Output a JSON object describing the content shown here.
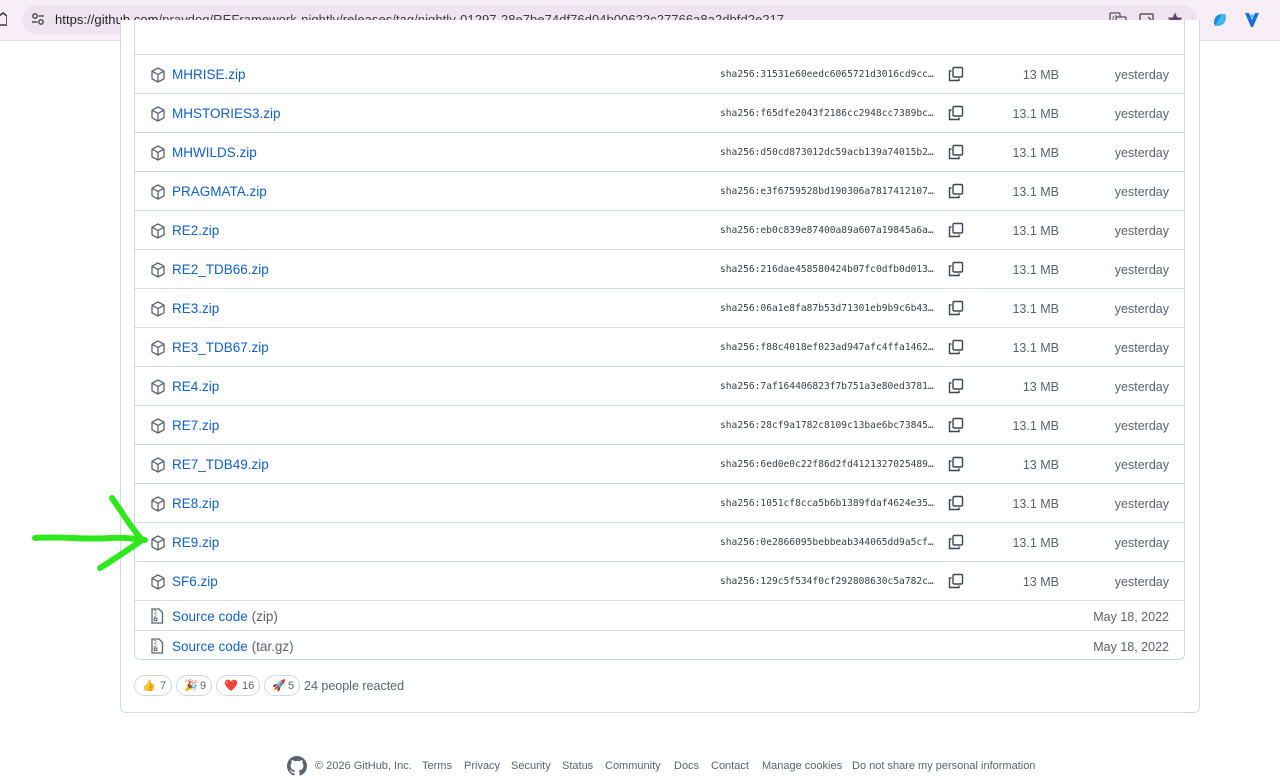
{
  "browser": {
    "url_host": "https://github.com",
    "url_path": "/praydog/REFramework-nightly/releases/tag/nightly-01297-28e7be74df76d04b00622c27766a8a2dbfd2e217",
    "icons": [
      "home-icon",
      "site-settings-icon",
      "translate-icon",
      "install-app-icon",
      "bookmark-star-icon",
      "copilot-icon",
      "extension-icon"
    ]
  },
  "assets": [
    {
      "name": "MHRISE.zip",
      "sha": "sha256:31531e60eedc6065721d3016cd9cc…",
      "size": "13 MB",
      "date": "yesterday"
    },
    {
      "name": "MHSTORIES3.zip",
      "sha": "sha256:f65dfe2043f2186cc2948cc7389bc…",
      "size": "13.1 MB",
      "date": "yesterday"
    },
    {
      "name": "MHWILDS.zip",
      "sha": "sha256:d50cd873012dc59acb139a74015b2…",
      "size": "13.1 MB",
      "date": "yesterday"
    },
    {
      "name": "PRAGMATA.zip",
      "sha": "sha256:e3f6759528bd190306a7817412107…",
      "size": "13.1 MB",
      "date": "yesterday"
    },
    {
      "name": "RE2.zip",
      "sha": "sha256:eb0c839e87400a89a607a19845a6a…",
      "size": "13.1 MB",
      "date": "yesterday"
    },
    {
      "name": "RE2_TDB66.zip",
      "sha": "sha256:216dae458580424b07fc0dfb0d013…",
      "size": "13.1 MB",
      "date": "yesterday"
    },
    {
      "name": "RE3.zip",
      "sha": "sha256:06a1e8fa87b53d71301eb9b9c6b43…",
      "size": "13.1 MB",
      "date": "yesterday"
    },
    {
      "name": "RE3_TDB67.zip",
      "sha": "sha256:f88c4018ef023ad947afc4ffa1462…",
      "size": "13.1 MB",
      "date": "yesterday"
    },
    {
      "name": "RE4.zip",
      "sha": "sha256:7af164406823f7b751a3e80ed3781…",
      "size": "13 MB",
      "date": "yesterday"
    },
    {
      "name": "RE7.zip",
      "sha": "sha256:28cf9a1782c8109c13bae6bc73845…",
      "size": "13.1 MB",
      "date": "yesterday"
    },
    {
      "name": "RE7_TDB49.zip",
      "sha": "sha256:6ed0e0c22f86d2fd4121327025489…",
      "size": "13 MB",
      "date": "yesterday"
    },
    {
      "name": "RE8.zip",
      "sha": "sha256:1051cf8cca5b6b1389fdaf4624e35…",
      "size": "13.1 MB",
      "date": "yesterday"
    },
    {
      "name": "RE9.zip",
      "sha": "sha256:0e2866095bebbeab344065dd9a5cf…",
      "size": "13.1 MB",
      "date": "yesterday"
    },
    {
      "name": "SF6.zip",
      "sha": "sha256:129c5f534f0cf292808630c5a782c…",
      "size": "13 MB",
      "date": "yesterday"
    }
  ],
  "source_code": [
    {
      "label": "Source code",
      "format": "(zip)",
      "date": "May 18, 2022"
    },
    {
      "label": "Source code",
      "format": "(tar.gz)",
      "date": "May 18, 2022"
    }
  ],
  "reactions": [
    {
      "emoji": "👍",
      "count": "7"
    },
    {
      "emoji": "🎉",
      "count": "9"
    },
    {
      "emoji": "❤️",
      "count": "16"
    },
    {
      "emoji": "🚀",
      "count": "5"
    }
  ],
  "reactions_summary": "24 people reacted",
  "footer": {
    "copyright": "© 2026 GitHub, Inc.",
    "links": [
      "Terms",
      "Privacy",
      "Security",
      "Status",
      "Community",
      "Docs",
      "Contact",
      "Manage cookies",
      "Do not share my personal information"
    ]
  },
  "annotation": {
    "color": "#2ee81c",
    "points_to": "RE9.zip"
  },
  "colors": {
    "link": "#1160c4",
    "muted": "#59636e",
    "border": "#d1d9e0"
  }
}
